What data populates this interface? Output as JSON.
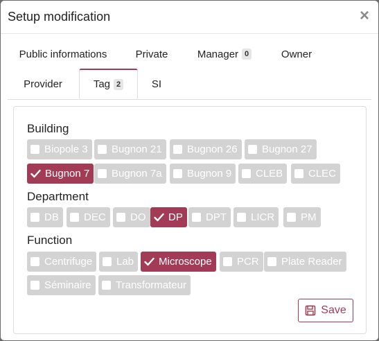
{
  "modal": {
    "title": "Setup modification"
  },
  "tabs": [
    {
      "label": "Public informations",
      "count": null,
      "active": false
    },
    {
      "label": "Private",
      "count": null,
      "active": false
    },
    {
      "label": "Manager",
      "count": "0",
      "active": false
    },
    {
      "label": "Owner",
      "count": null,
      "active": false
    },
    {
      "label": "Provider",
      "count": null,
      "active": false
    },
    {
      "label": "Tag",
      "count": "2",
      "active": true
    },
    {
      "label": "SI",
      "count": null,
      "active": false
    }
  ],
  "groups": {
    "building": {
      "label": "Building",
      "tags": [
        {
          "label": "Biopole 3",
          "selected": false
        },
        {
          "label": "Bugnon 21",
          "selected": false
        },
        {
          "label": "Bugnon 26",
          "selected": false
        },
        {
          "label": "Bugnon 27",
          "selected": false
        },
        {
          "label": "Bugnon 7",
          "selected": true
        },
        {
          "label": "Bugnon 7a",
          "selected": false
        },
        {
          "label": "Bugnon 9",
          "selected": false
        },
        {
          "label": "CLEB",
          "selected": false
        },
        {
          "label": "CLEC",
          "selected": false
        }
      ]
    },
    "department": {
      "label": "Department",
      "tags": [
        {
          "label": "DB",
          "selected": false
        },
        {
          "label": "DEC",
          "selected": false
        },
        {
          "label": "DO",
          "selected": false
        },
        {
          "label": "DP",
          "selected": true
        },
        {
          "label": "DPT",
          "selected": false
        },
        {
          "label": "LICR",
          "selected": false
        },
        {
          "label": "PM",
          "selected": false
        }
      ]
    },
    "function": {
      "label": "Function",
      "tags": [
        {
          "label": "Centrifuge",
          "selected": false
        },
        {
          "label": "Lab",
          "selected": false
        },
        {
          "label": "Microscope",
          "selected": true
        },
        {
          "label": "PCR",
          "selected": false
        },
        {
          "label": "Plate Reader",
          "selected": false
        },
        {
          "label": "Séminaire",
          "selected": false
        },
        {
          "label": "Transformateur",
          "selected": false
        }
      ]
    }
  },
  "save": {
    "label": "Save"
  },
  "colors": {
    "accent": "#a23b56",
    "unselected_chip": "#d3d3d3"
  }
}
